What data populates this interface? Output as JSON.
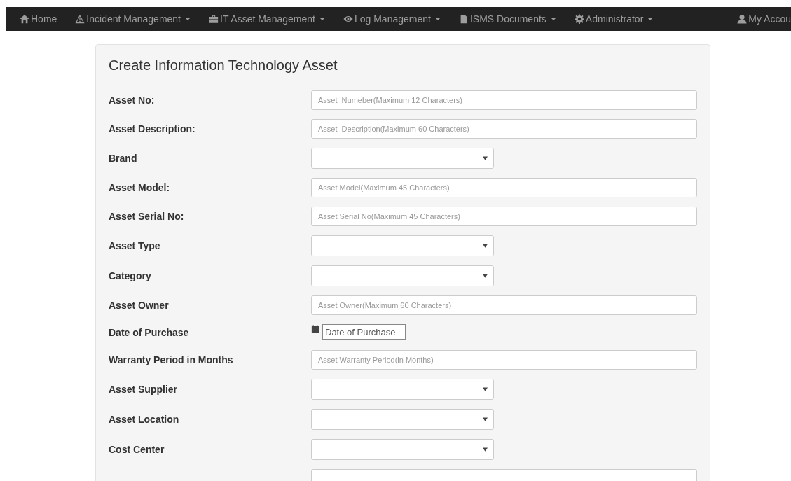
{
  "navbar": {
    "items": [
      {
        "label": "Home",
        "caret": false
      },
      {
        "label": "Incident Management",
        "caret": true
      },
      {
        "label": "IT Asset Management",
        "caret": true
      },
      {
        "label": "Log Management",
        "caret": true
      },
      {
        "label": "ISMS Documents",
        "caret": true
      },
      {
        "label": "Administrator",
        "caret": true
      }
    ],
    "account": {
      "label": "My Accou"
    }
  },
  "form": {
    "title": "Create Information Technology Asset",
    "fields": [
      {
        "kind": "text",
        "label": "Asset No:",
        "placeholder": "Asset  Numeber(Maximum 12 Characters)"
      },
      {
        "kind": "text",
        "label": "Asset Description:",
        "placeholder": "Asset  Description(Maximum 60 Characters)"
      },
      {
        "kind": "select",
        "label": "Brand"
      },
      {
        "kind": "text",
        "label": "Asset Model:",
        "placeholder": "Asset Model(Maximum 45 Characters)"
      },
      {
        "kind": "text",
        "label": "Asset Serial No:",
        "placeholder": "Asset Serial No(Maximum 45 Characters)"
      },
      {
        "kind": "select",
        "label": "Asset Type"
      },
      {
        "kind": "select",
        "label": "Category"
      },
      {
        "kind": "text",
        "label": "Asset Owner",
        "placeholder": "Asset Owner(Maximum 60 Characters)"
      },
      {
        "kind": "date",
        "label": "Date of Purchase",
        "placeholder": "Date of Purchase"
      },
      {
        "kind": "text",
        "label": "Warranty Period in Months",
        "placeholder": "Asset Warranty Period(in Months)"
      },
      {
        "kind": "select",
        "label": "Asset Supplier"
      },
      {
        "kind": "select",
        "label": "Asset Location"
      },
      {
        "kind": "select",
        "label": "Cost Center"
      },
      {
        "kind": "text"
      }
    ]
  }
}
